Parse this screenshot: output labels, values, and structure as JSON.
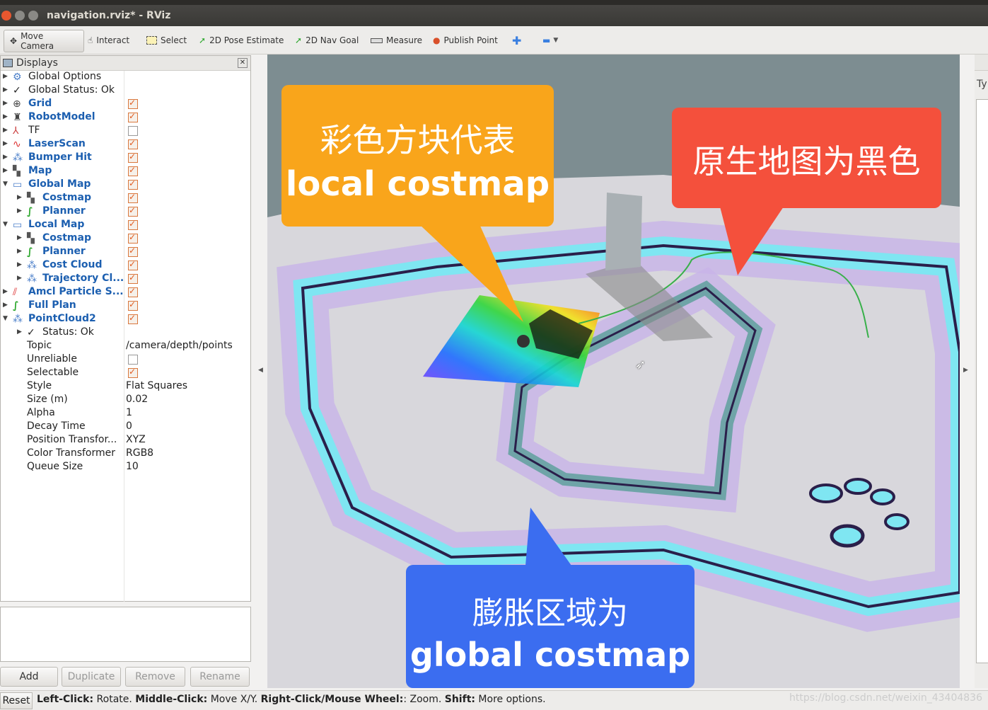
{
  "window": {
    "title": "navigation.rviz* - RViz"
  },
  "toolbar": {
    "move_camera": "Move Camera",
    "interact": "Interact",
    "select": "Select",
    "pose_estimate": "2D Pose Estimate",
    "nav_goal": "2D Nav Goal",
    "measure": "Measure",
    "publish_point": "Publish Point"
  },
  "displays": {
    "title": "Displays",
    "items": [
      {
        "label": "Global Options"
      },
      {
        "label": "Global Status: Ok"
      },
      {
        "label": "Grid"
      },
      {
        "label": "RobotModel"
      },
      {
        "label": "TF"
      },
      {
        "label": "LaserScan"
      },
      {
        "label": "Bumper Hit"
      },
      {
        "label": "Map"
      },
      {
        "label": "Global Map"
      },
      {
        "label": "Costmap"
      },
      {
        "label": "Planner"
      },
      {
        "label": "Local Map"
      },
      {
        "label": "Costmap"
      },
      {
        "label": "Planner"
      },
      {
        "label": "Cost Cloud"
      },
      {
        "label": "Trajectory Cl..."
      },
      {
        "label": "Amcl Particle S..."
      },
      {
        "label": "Full Plan"
      },
      {
        "label": "PointCloud2"
      },
      {
        "label": "Status: Ok"
      }
    ],
    "props": [
      {
        "label": "Topic",
        "value": "/camera/depth/points"
      },
      {
        "label": "Unreliable",
        "value": ""
      },
      {
        "label": "Selectable",
        "value": ""
      },
      {
        "label": "Style",
        "value": "Flat Squares"
      },
      {
        "label": "Size (m)",
        "value": "0.02"
      },
      {
        "label": "Alpha",
        "value": "1"
      },
      {
        "label": "Decay Time",
        "value": "0"
      },
      {
        "label": "Position Transfor...",
        "value": "XYZ"
      },
      {
        "label": "Color Transformer",
        "value": "RGB8"
      },
      {
        "label": "Queue Size",
        "value": "10"
      }
    ]
  },
  "buttons": {
    "add": "Add",
    "duplicate": "Duplicate",
    "remove": "Remove",
    "rename": "Rename"
  },
  "callouts": {
    "local_line1": "彩色方块代表",
    "local_line2": "local costmap",
    "map_line1": "原生地图为黑色",
    "global_line1": "膨胀区域为",
    "global_line2": "global costmap"
  },
  "status": {
    "reset": "Reset",
    "k1": "Left-Click:",
    "t1": " Rotate. ",
    "k2": "Middle-Click:",
    "t2": " Move X/Y. ",
    "k3": "Right-Click/Mouse Wheel:",
    "t3": ": Zoom. ",
    "k4": "Shift:",
    "t4": " More options.",
    "watermark": "https://blog.csdn.net/weixin_43404836"
  },
  "right_panel": {
    "label": "Ty"
  },
  "colors": {
    "orange": "#f9a51b",
    "red": "#f4503c",
    "blue": "#3b6df0",
    "accent": "#1c5fb0"
  }
}
